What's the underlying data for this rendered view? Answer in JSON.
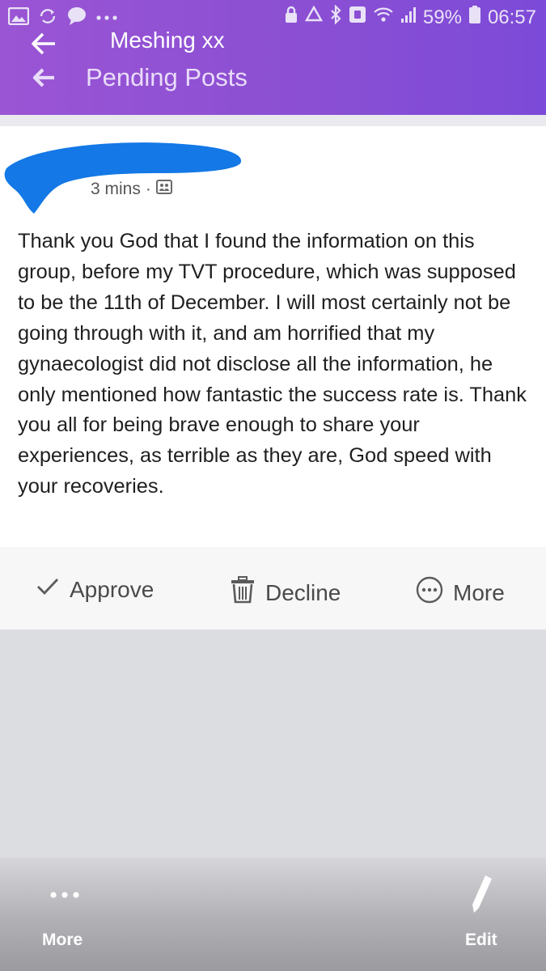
{
  "status_bar": {
    "battery": "59%",
    "time": "06:57"
  },
  "header": {
    "group_name": "Meshing xx",
    "title": "Pending Posts"
  },
  "post": {
    "time_ago": "3 mins",
    "separator": "·",
    "body": "Thank you God that I found the information on this group, before my TVT procedure, which was supposed to be the 11th of December. I will most certainly not be going through with it, and am horrified that my gynaecologist did not disclose all the information, he only mentioned how fantastic the success rate is. Thank you all for being brave enough to share your experiences, as terrible as they are, God speed with your recoveries."
  },
  "actions": {
    "approve": "Approve",
    "decline": "Decline",
    "more": "More"
  },
  "bottom_bar": {
    "more": "More",
    "edit": "Edit"
  },
  "colors": {
    "header": "#8b4fd3",
    "redaction": "#1478e6"
  }
}
